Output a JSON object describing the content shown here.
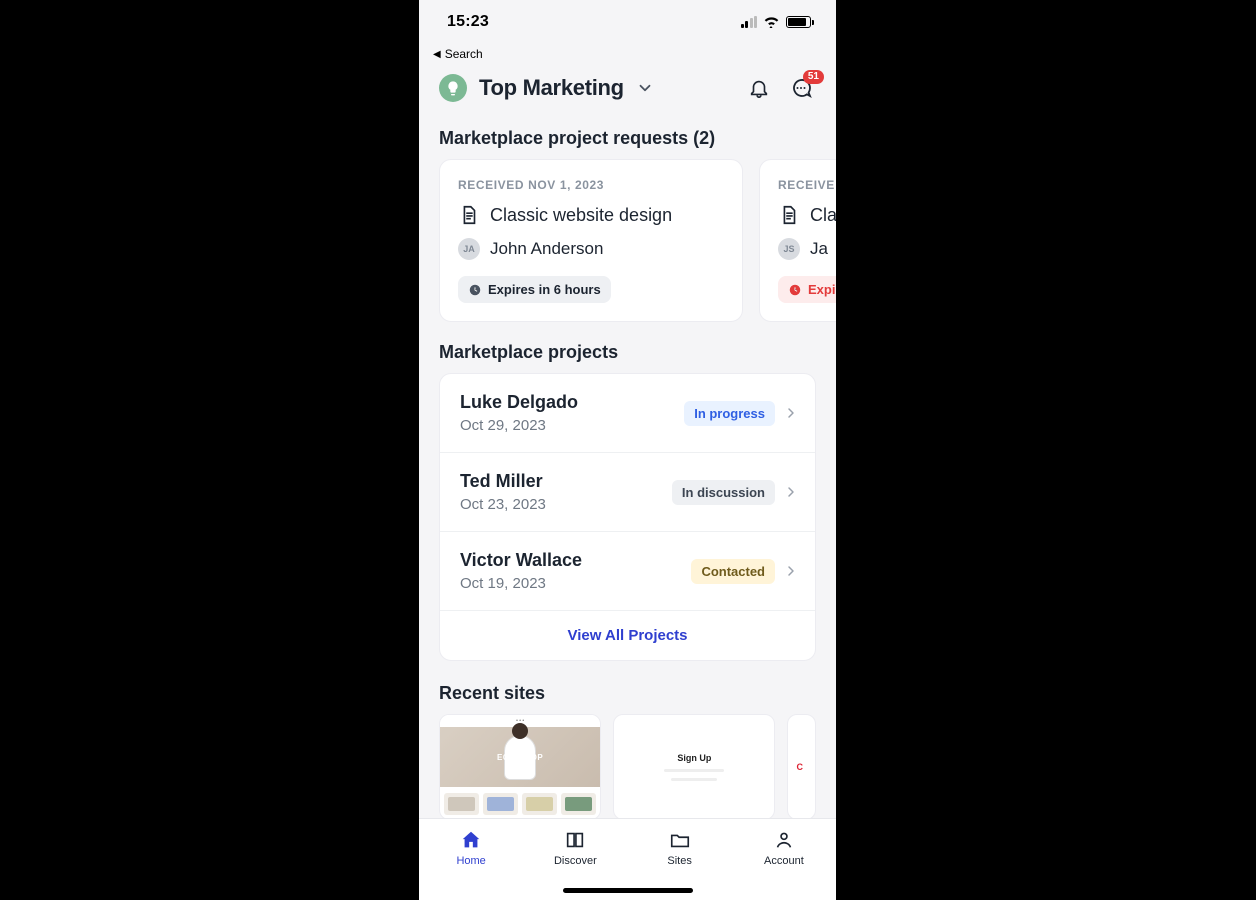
{
  "status_bar": {
    "time": "15:23"
  },
  "back_link": "Search",
  "header": {
    "workspace_name": "Top Marketing",
    "chat_badge": "51"
  },
  "requests_section": {
    "heading": "Marketplace project requests (2)",
    "cards": [
      {
        "received": "RECEIVED NOV 1, 2023",
        "title": "Classic website design",
        "person_initials": "JA",
        "person_name": "John Anderson",
        "expiry": "Expires in 6 hours",
        "expiry_style": "normal"
      },
      {
        "received": "RECEIVE",
        "title": "Cla",
        "person_initials": "JS",
        "person_name": "Ja",
        "expiry": "Expir",
        "expiry_style": "red"
      }
    ]
  },
  "projects_section": {
    "heading": "Marketplace projects",
    "items": [
      {
        "name": "Luke Delgado",
        "date": "Oct 29, 2023",
        "status": "In progress",
        "status_kind": "progress"
      },
      {
        "name": "Ted Miller",
        "date": "Oct 23, 2023",
        "status": "In discussion",
        "status_kind": "discussion"
      },
      {
        "name": "Victor Wallace",
        "date": "Oct 19, 2023",
        "status": "Contacted",
        "status_kind": "contacted"
      }
    ],
    "view_all": "View All Projects"
  },
  "recent_sites": {
    "heading": "Recent sites",
    "site1_label": "ECO SHOP",
    "site2_label": "Sign Up",
    "site3_label": "C"
  },
  "tabs": {
    "home": "Home",
    "discover": "Discover",
    "sites": "Sites",
    "account": "Account"
  }
}
